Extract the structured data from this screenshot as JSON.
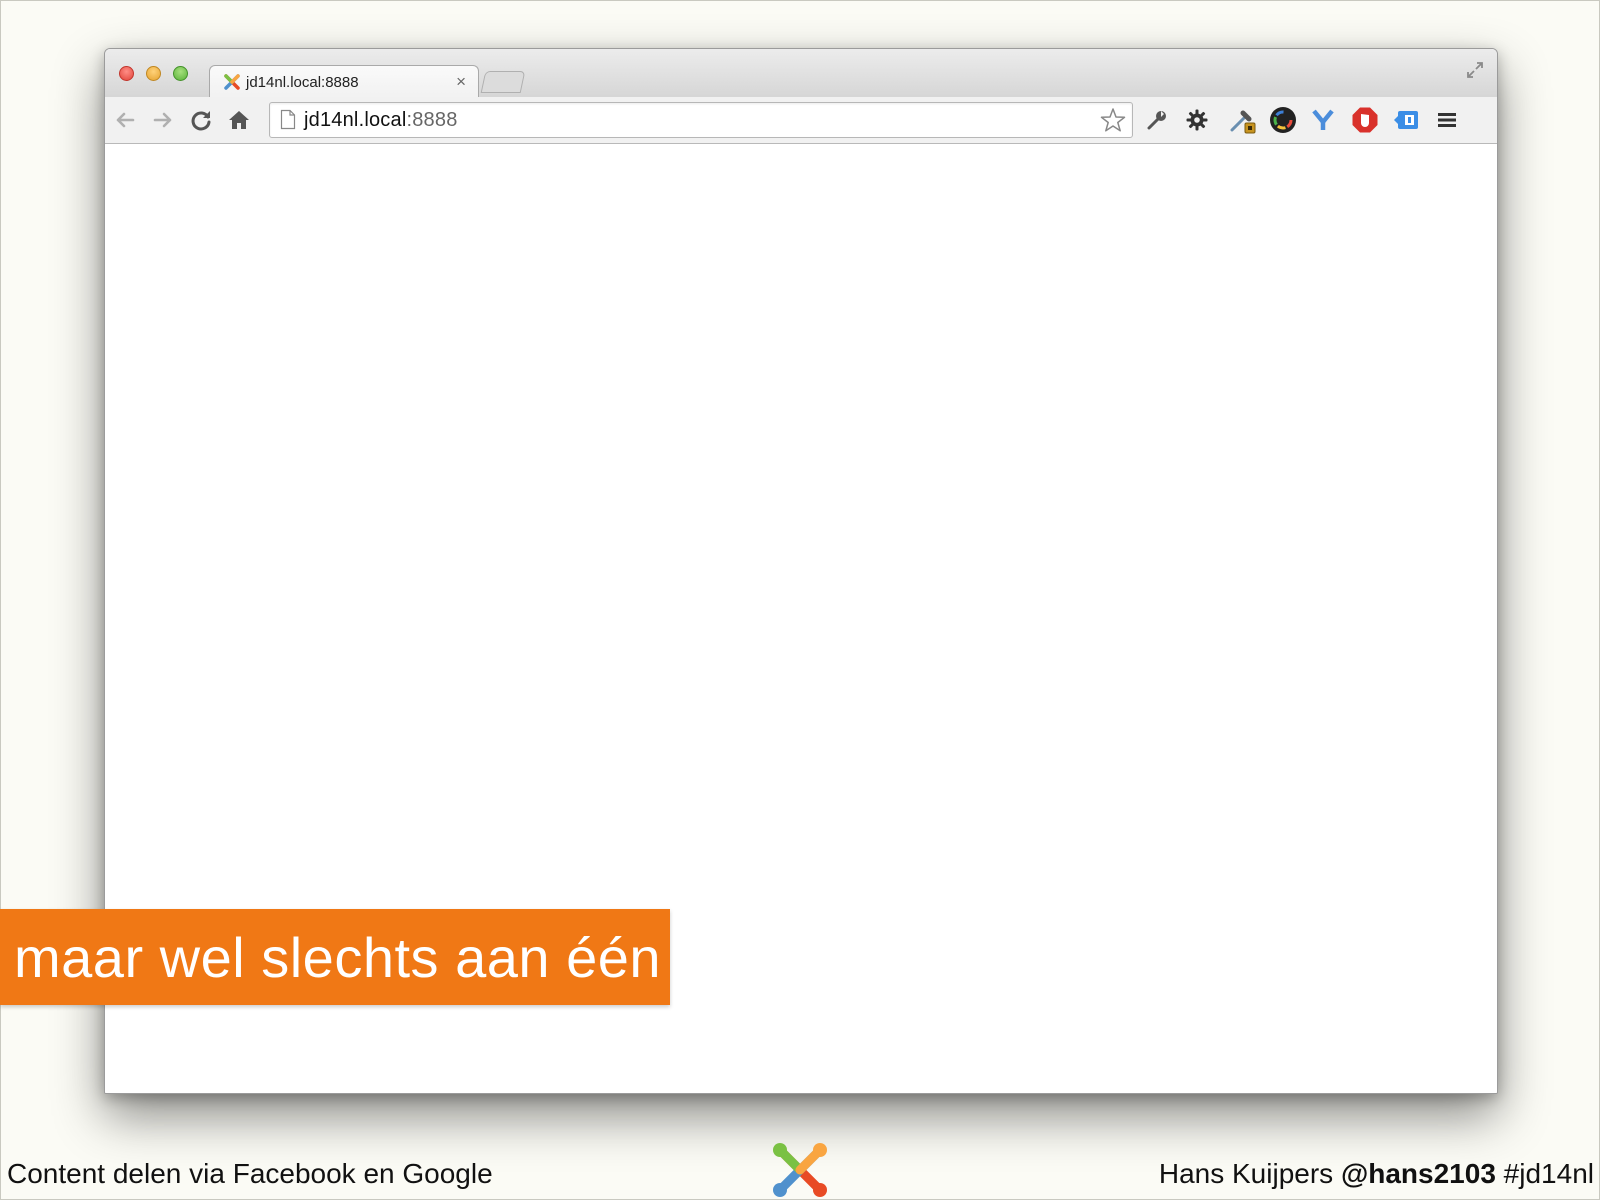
{
  "browser": {
    "tab_title": "jd14nl.local:8888",
    "tab_close": "×",
    "url_host": "jd14nl.local",
    "url_port": ":8888"
  },
  "caption": {
    "text": "maar wel slechts aan één",
    "color": "#f07815"
  },
  "footer": {
    "left_text": "Content delen via Facebook en Google",
    "author": "Hans Kuijpers ",
    "handle": "@hans2103",
    "hashtag": " #jd14nl"
  },
  "icons": {
    "favicon": "joomla-logo-icon",
    "toolbar_extensions": [
      "wrench-icon",
      "gear-icon",
      "eyedropper-icon",
      "color-wheel-icon",
      "y-slow-icon",
      "adblock-icon",
      "extension-blue-icon",
      "menu-icon"
    ]
  }
}
